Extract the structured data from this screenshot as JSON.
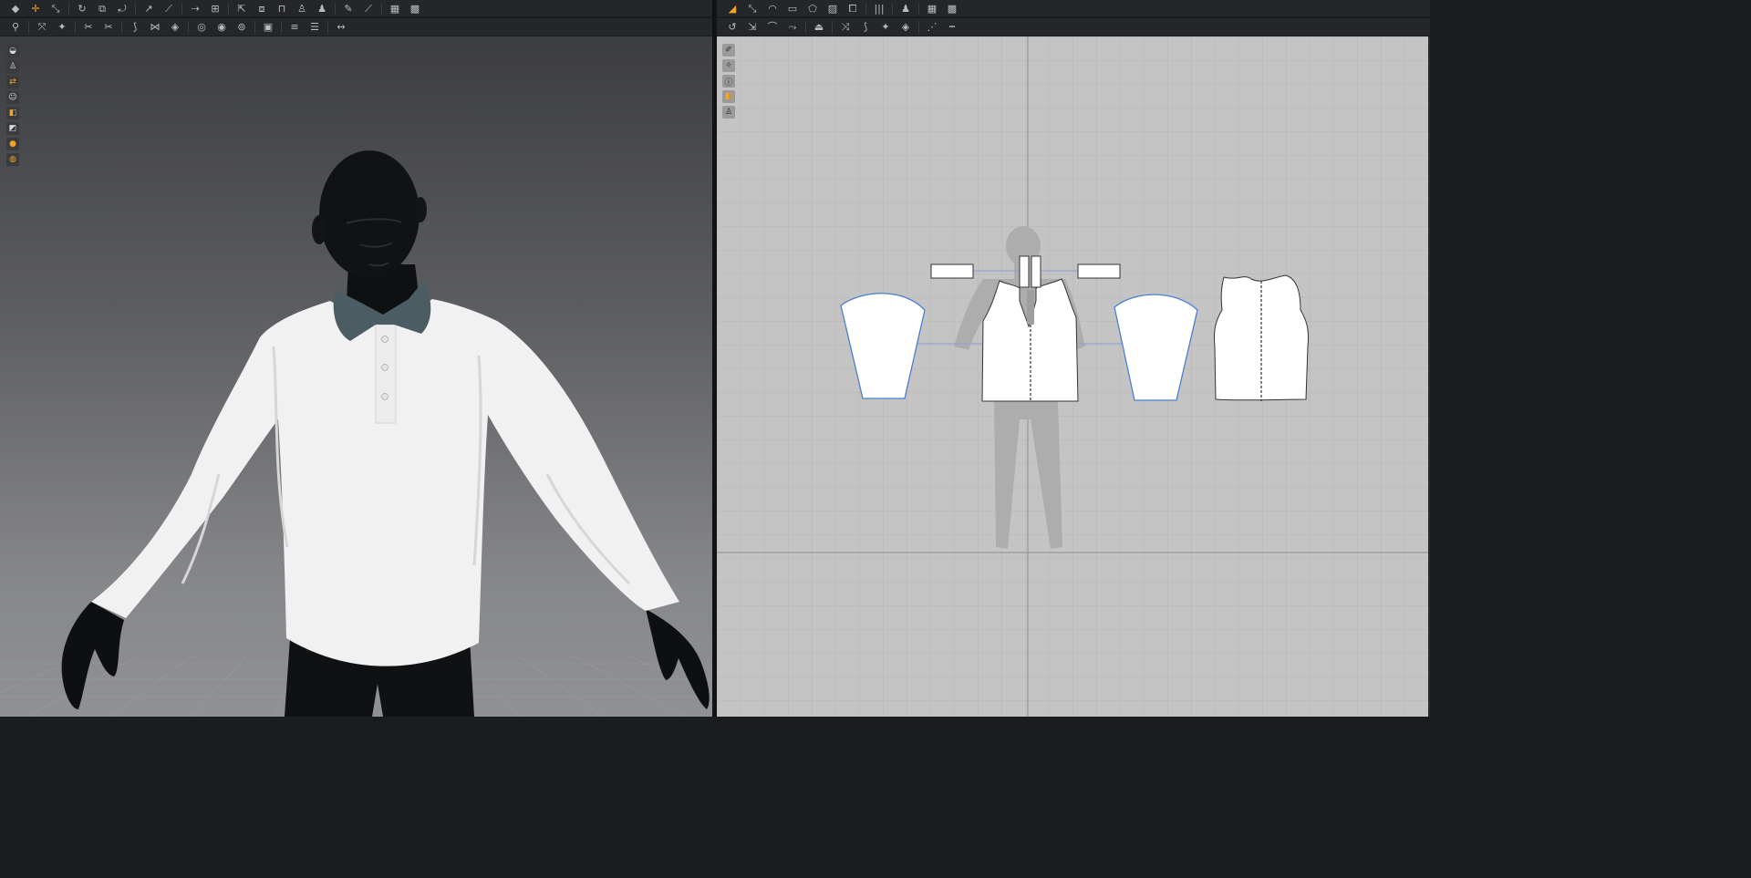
{
  "toolbar_3d": {
    "row1": [
      {
        "icon": "select-move-icon"
      },
      {
        "icon": "add-point-icon",
        "accent": true
      },
      {
        "icon": "edit-pin-icon"
      },
      "sep",
      {
        "icon": "rotate-icon"
      },
      {
        "icon": "fold-arrange-icon"
      },
      {
        "icon": "tack-icon"
      },
      "sep",
      {
        "icon": "measure-icon"
      },
      {
        "icon": "line-measure-icon"
      },
      "sep",
      {
        "icon": "zipper-icon"
      },
      {
        "icon": "button-icon"
      },
      "sep",
      {
        "icon": "avatar-pose-icon"
      },
      {
        "icon": "garment-front-icon"
      },
      {
        "icon": "garment-book-icon"
      },
      {
        "icon": "tshirt-icon"
      },
      {
        "icon": "avatar-icon"
      },
      "sep",
      {
        "icon": "pencil-icon"
      },
      {
        "icon": "brush-icon"
      },
      "sep",
      {
        "icon": "grid-icon"
      },
      {
        "icon": "grid-alt-icon"
      }
    ],
    "row2": [
      {
        "icon": "walk-icon"
      },
      "sep",
      {
        "icon": "fabric-select-icon"
      },
      {
        "icon": "pin-icon"
      },
      "sep",
      {
        "icon": "cut-icon"
      },
      {
        "icon": "scissors-icon"
      },
      "sep",
      {
        "icon": "seam-icon"
      },
      {
        "icon": "stitch-icon"
      },
      {
        "icon": "diamond-icon"
      },
      "sep",
      {
        "icon": "target-icon"
      },
      {
        "icon": "button-round-icon"
      },
      {
        "icon": "buttonhole-icon"
      },
      "sep",
      {
        "icon": "fabric-roll-icon"
      },
      "sep",
      {
        "icon": "layer-icon"
      },
      {
        "icon": "stack-icon"
      },
      "sep",
      {
        "icon": "ruler-move-icon"
      }
    ]
  },
  "toolbar_2d": {
    "row1": [
      {
        "icon": "transform-pattern-icon",
        "accent": true
      },
      {
        "icon": "edit-points-icon"
      },
      {
        "icon": "curve-icon"
      },
      {
        "icon": "rectangle-icon"
      },
      {
        "icon": "polygon-icon"
      },
      {
        "icon": "image-icon"
      },
      {
        "icon": "trace-icon"
      },
      "sep",
      {
        "icon": "pleats-icon"
      },
      "sep",
      {
        "icon": "avatar-2d-icon"
      },
      "sep",
      {
        "icon": "grid-icon"
      },
      {
        "icon": "grid-alt-icon"
      }
    ],
    "row2": [
      {
        "icon": "rotate-2d-icon"
      },
      {
        "icon": "offset-icon"
      },
      {
        "icon": "arc-icon"
      },
      {
        "icon": "sew-icon"
      },
      "sep",
      {
        "icon": "iron-icon"
      },
      "sep",
      {
        "icon": "free-sew-icon"
      },
      {
        "icon": "seam-2d-icon"
      },
      {
        "icon": "pin-2d-icon"
      },
      {
        "icon": "diamond-icon"
      },
      "sep",
      {
        "icon": "dash-line-icon"
      },
      {
        "icon": "dots-line-icon"
      }
    ]
  },
  "side_3d": [
    {
      "icon": "helmet-icon"
    },
    {
      "icon": "shirt-icon"
    },
    {
      "icon": "swap-icon",
      "orange": true
    },
    {
      "icon": "avatar-user-icon"
    },
    {
      "icon": "texture-icon",
      "orange": true
    },
    {
      "icon": "fold-icon"
    },
    {
      "icon": "skin-icon",
      "orange": true
    },
    {
      "icon": "sphere-icon",
      "orange": true
    }
  ],
  "side_2d": [
    {
      "icon": "pen-icon"
    },
    {
      "icon": "magic-wand-icon"
    },
    {
      "icon": "info-icon"
    },
    {
      "icon": "color-swatch-icon",
      "orange": true
    },
    {
      "icon": "lock-shirt-icon"
    }
  ],
  "colors": {
    "collar": "#4b5d63",
    "shirt": "#f2f2f2",
    "avatar": "#101113",
    "seam_line": "#4a7fd1",
    "accent": "#f2a323"
  }
}
